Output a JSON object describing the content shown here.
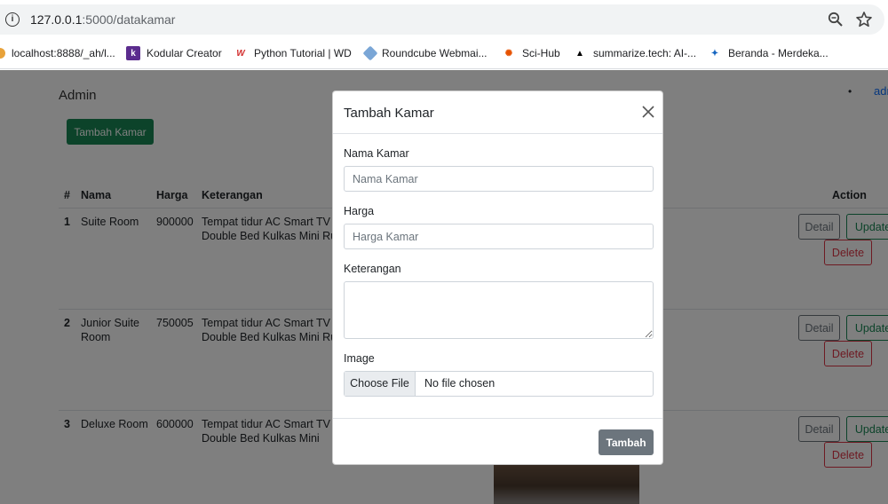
{
  "browser": {
    "url_host": "127.0.0.1",
    "url_path": ":5000/datakamar",
    "bookmarks": [
      {
        "label": "localhost:8888/_ah/l...",
        "icon": "folder-icon"
      },
      {
        "label": "Kodular Creator",
        "icon": "kodular-icon"
      },
      {
        "label": "Python Tutorial | WD",
        "icon": "wd-icon"
      },
      {
        "label": "Roundcube Webmai...",
        "icon": "roundcube-icon"
      },
      {
        "label": "Sci-Hub",
        "icon": "scihub-icon"
      },
      {
        "label": "summarize.tech: AI-...",
        "icon": "triangle-icon"
      },
      {
        "label": "Beranda - Merdeka...",
        "icon": "merdeka-icon"
      }
    ]
  },
  "page": {
    "brand": "Admin",
    "nav_link": "adm",
    "add_button": "Tambah Kamar",
    "table": {
      "headers": [
        "#",
        "Nama",
        "Harga",
        "Keterangan",
        "Action"
      ],
      "rows": [
        {
          "no": "1",
          "nama": "Suite Room",
          "harga": "900000",
          "ket1": "Tempat tidur AC Smart TV B",
          "ket2": "Double Bed Kulkas Mini Rua"
        },
        {
          "no": "2",
          "nama": "Junior Suite",
          "nama2": "Room",
          "harga": "750005",
          "ket1": "Tempat tidur AC Smart TV B",
          "ket2": "Double Bed Kulkas Mini Rua"
        },
        {
          "no": "3",
          "nama": "Deluxe Room",
          "harga": "600000",
          "ket1": "Tempat tidur AC Smart TV B",
          "ket2": "Double Bed Kulkas Mini"
        }
      ],
      "detail_label": "Detail",
      "update_label": "Update",
      "delete_label": "Delete"
    }
  },
  "modal": {
    "title": "Tambah Kamar",
    "nama_label": "Nama Kamar",
    "nama_placeholder": "Nama Kamar",
    "harga_label": "Harga",
    "harga_placeholder": "Harga Kamar",
    "keterangan_label": "Keterangan",
    "image_label": "Image",
    "file_button": "Choose File",
    "file_status": "No file chosen",
    "submit_label": "Tambah"
  }
}
